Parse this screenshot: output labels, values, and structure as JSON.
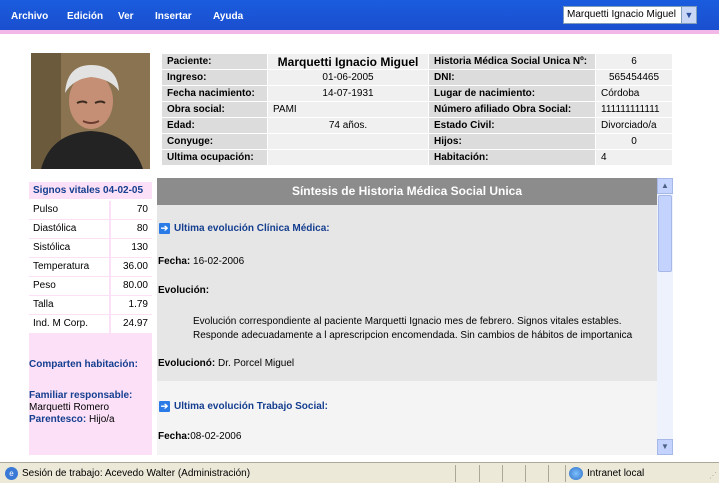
{
  "menu": {
    "items": [
      "Archivo",
      "Edición",
      "Ver",
      "Insertar",
      "Ayuda"
    ],
    "patient_select": "Marquetti Ignacio Miguel"
  },
  "patient": {
    "rows": [
      {
        "label": "Paciente:",
        "value": "Marquetti Ignacio Miguel",
        "label2": "Historia Médica Social Unica Nº:",
        "value2": "6"
      },
      {
        "label": "Ingreso:",
        "value": "01-06-2005",
        "label2": "DNI:",
        "value2": "565454465"
      },
      {
        "label": "Fecha nacimiento:",
        "value": "14-07-1931",
        "label2": "Lugar de nacimiento:",
        "value2": "Córdoba"
      },
      {
        "label": "Obra social:",
        "value": "PAMI",
        "label2": "Número afiliado Obra Social:",
        "value2": "111111111111"
      },
      {
        "label": "Edad:",
        "value": "74 años.",
        "label2": "Estado Civil:",
        "value2": "Divorciado/a"
      },
      {
        "label": "Conyuge:",
        "value": "",
        "label2": "Hijos:",
        "value2": "0"
      },
      {
        "label": "Ultima ocupación:",
        "value": "",
        "label2": "Habitación:",
        "value2": "4"
      }
    ]
  },
  "vitals": {
    "title": "Signos vitales 04-02-05",
    "rows": [
      {
        "name": "Pulso",
        "value": "70"
      },
      {
        "name": "Diastólica",
        "value": "80"
      },
      {
        "name": "Sistólica",
        "value": "130"
      },
      {
        "name": "Temperatura",
        "value": "36.00"
      },
      {
        "name": "Peso",
        "value": "80.00"
      },
      {
        "name": "Talla",
        "value": "1.79"
      },
      {
        "name": "Ind. M Corp.",
        "value": "24.97"
      }
    ]
  },
  "left": {
    "share_title": "Comparten habitación:",
    "family_title": "Familiar responsable:",
    "family_name": "Marquetti Romero",
    "relation_label": "Parentesco:",
    "relation_value": "Hijo/a"
  },
  "synthesis": {
    "title": "Síntesis de Historia Médica Social Unica",
    "clinical": {
      "title": "Ultima evolución Clínica Médica:",
      "date_label": "Fecha:",
      "date": "16-02-2006",
      "evo_label": "Evolución:",
      "evo_line1": "Evolución correspondiente al paciente Marquetti Ignacio mes de febrero. Signos vitales estables.",
      "evo_line2": "Responde adecuadamente a l aprescripcion encomendada. Sin cambios de hábitos de importanica",
      "by_label": "Evolucionó:",
      "by": "Dr. Porcel Miguel"
    },
    "social": {
      "title": "Ultima evolución Trabajo Social:",
      "date_label": "Fecha:",
      "date": "08-02-2006"
    }
  },
  "status": {
    "session": "Sesión de trabajo: Acevedo Walter (Administración)",
    "zone": "Intranet local"
  }
}
